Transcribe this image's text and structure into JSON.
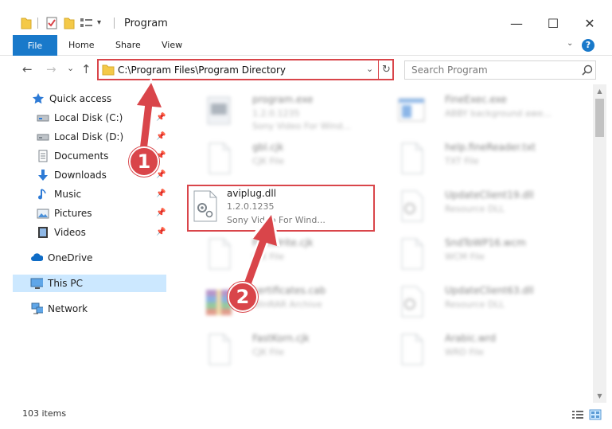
{
  "window": {
    "title": "Program",
    "minimize": "—",
    "maximize": "☐",
    "close": "✕"
  },
  "ribbon": {
    "tabs": [
      "File",
      "Home",
      "Share",
      "View"
    ],
    "help": "?"
  },
  "address": {
    "path": "C:\\Program Files\\Program Directory",
    "dropdown": "⌄",
    "refresh": "↻"
  },
  "search": {
    "placeholder": "Search Program"
  },
  "nav_buttons": {
    "back": "←",
    "forward": "→",
    "recent": "⌄",
    "up": "↑"
  },
  "nav_pane": {
    "items": [
      {
        "label": "Quick access",
        "icon": "star-icon",
        "pinned": false
      },
      {
        "label": "Local Disk (C:)",
        "icon": "drive-icon",
        "pinned": true
      },
      {
        "label": "Local Disk (D:)",
        "icon": "drive-icon",
        "pinned": true
      },
      {
        "label": "Documents",
        "icon": "documents-icon",
        "pinned": true
      },
      {
        "label": "Downloads",
        "icon": "download-icon",
        "pinned": true
      },
      {
        "label": "Music",
        "icon": "music-icon",
        "pinned": true
      },
      {
        "label": "Pictures",
        "icon": "pictures-icon",
        "pinned": true
      },
      {
        "label": "Videos",
        "icon": "videos-icon",
        "pinned": true
      },
      {
        "label": "OneDrive",
        "icon": "cloud-icon",
        "pinned": false
      },
      {
        "label": "This PC",
        "icon": "computer-icon",
        "pinned": false,
        "selected": true
      },
      {
        "label": "Network",
        "icon": "network-icon",
        "pinned": false
      }
    ]
  },
  "files": [
    {
      "name": "program.exe",
      "line2": "1.2.0.1235",
      "line3": "Sony Video For Wind...",
      "icon": "exe-icon"
    },
    {
      "name": "FineExec.exe",
      "line2": "ABBY background awe...",
      "line3": "",
      "icon": "window-icon"
    },
    {
      "name": "gbl.cjk",
      "line2": "CJK File",
      "line3": "",
      "icon": "file-icon"
    },
    {
      "name": "help.fineReader.txt",
      "line2": "TXT File",
      "line3": "",
      "icon": "file-icon"
    },
    {
      "name": "aviplug.dll",
      "line2": "1.2.0.1235",
      "line3": "Sony Video For Wind...",
      "icon": "dll-gear-icon"
    },
    {
      "name": "UpdateClient19.dll",
      "line2": "Resource DLL",
      "line3": "",
      "icon": "dll-gear-icon"
    },
    {
      "name": "FastWrite.cjk",
      "line2": "CJK File",
      "line3": "",
      "icon": "file-icon"
    },
    {
      "name": "SndToWP16.wcm",
      "line2": "WCM File",
      "line3": "",
      "icon": "file-icon"
    },
    {
      "name": "certificates.cab",
      "line2": "WinRAR Archive",
      "line3": "",
      "icon": "archive-icon"
    },
    {
      "name": "UpdateClient63.dll",
      "line2": "Resource DLL",
      "line3": "",
      "icon": "dll-gear-icon"
    },
    {
      "name": "FastKorn.cjk",
      "line2": "CJK File",
      "line3": "",
      "icon": "file-icon"
    },
    {
      "name": "Arabic.wrd",
      "line2": "WRD File",
      "line3": "",
      "icon": "file-icon"
    }
  ],
  "status": {
    "items_count": "103 items"
  },
  "annotations": {
    "step1": "1",
    "step2": "2",
    "accent": "#d9454a"
  },
  "colors": {
    "file_tab": "#1979ca",
    "selection": "#cce8ff",
    "highlight": "#d9454a"
  }
}
